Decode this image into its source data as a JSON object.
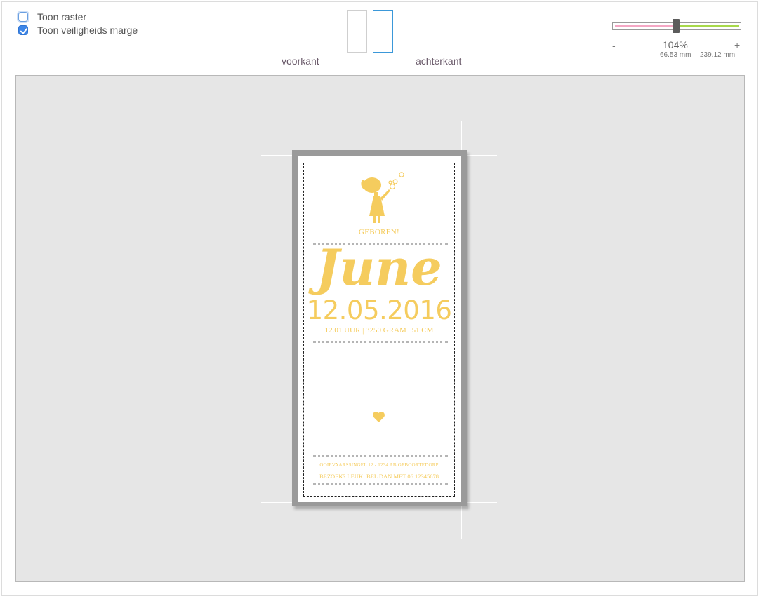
{
  "options": {
    "grid_label": "Toon raster",
    "grid_checked": false,
    "safety_label": "Toon veiligheids marge",
    "safety_checked": true
  },
  "pages": {
    "front_label": "voorkant",
    "back_label": "achterkant",
    "selected": "achterkant"
  },
  "zoom": {
    "minus": "-",
    "plus": "+",
    "percent": "104%",
    "value": 0.5,
    "width_mm": "66.53 mm",
    "height_mm": "239.12 mm"
  },
  "card": {
    "born": "GEBOREN!",
    "name": "June",
    "date": "12.05.2016",
    "details": "12.01 UUR  |  3250 GRAM  |  51 CM",
    "address": "OOIEVAARSSINGEL 12   -   1234 AB  GEBOORTEDORP",
    "visit": "BEZOEK? LEUK! BEL DAN MET 06 12345678",
    "accent_color": "#f5cc5e",
    "icons": [
      "girl-blowing-bubbles-icon",
      "heart-icon"
    ]
  },
  "colors": {
    "canvas": "#e6e6e6",
    "checkbox_blue": "#3d86e8",
    "slider_left": "#f4a7c4",
    "slider_right": "#a8d94a"
  }
}
